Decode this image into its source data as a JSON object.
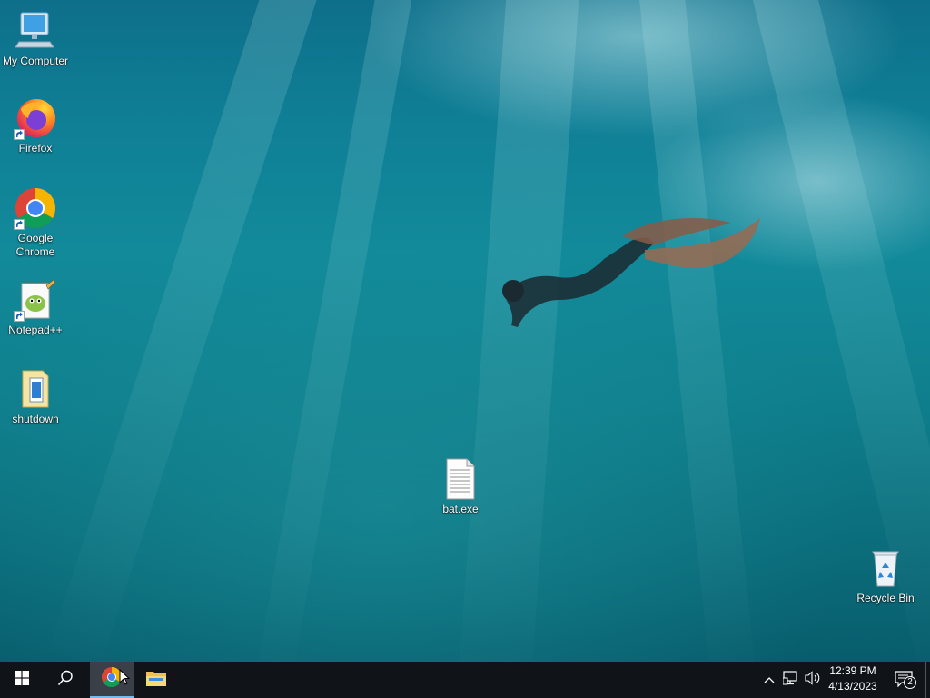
{
  "desktop": {
    "icons": [
      {
        "label": "My Computer",
        "icon": "computer-icon"
      },
      {
        "label": "Firefox",
        "icon": "firefox-icon"
      },
      {
        "label": "Google Chrome",
        "icon": "chrome-icon"
      },
      {
        "label": "Notepad++",
        "icon": "notepad-plus-plus-icon"
      },
      {
        "label": "shutdown",
        "icon": "batch-file-icon"
      },
      {
        "label": "bat.exe",
        "icon": "text-file-icon"
      },
      {
        "label": "Recycle Bin",
        "icon": "recycle-bin-icon"
      }
    ]
  },
  "taskbar": {
    "start_icon": "windows-logo-icon",
    "search_icon": "search-icon",
    "pinned": [
      {
        "name": "Google Chrome",
        "icon": "chrome-icon",
        "active": true
      },
      {
        "name": "File Explorer",
        "icon": "folder-icon",
        "active": false
      }
    ],
    "tray": {
      "icons": [
        "chevron-up-icon",
        "network-icon",
        "volume-icon"
      ],
      "time": "12:39 PM",
      "date": "4/13/2023",
      "notification_count": "2"
    }
  },
  "colors": {
    "taskbar_bg": "#101419",
    "active_underline": "#76b9ed"
  }
}
